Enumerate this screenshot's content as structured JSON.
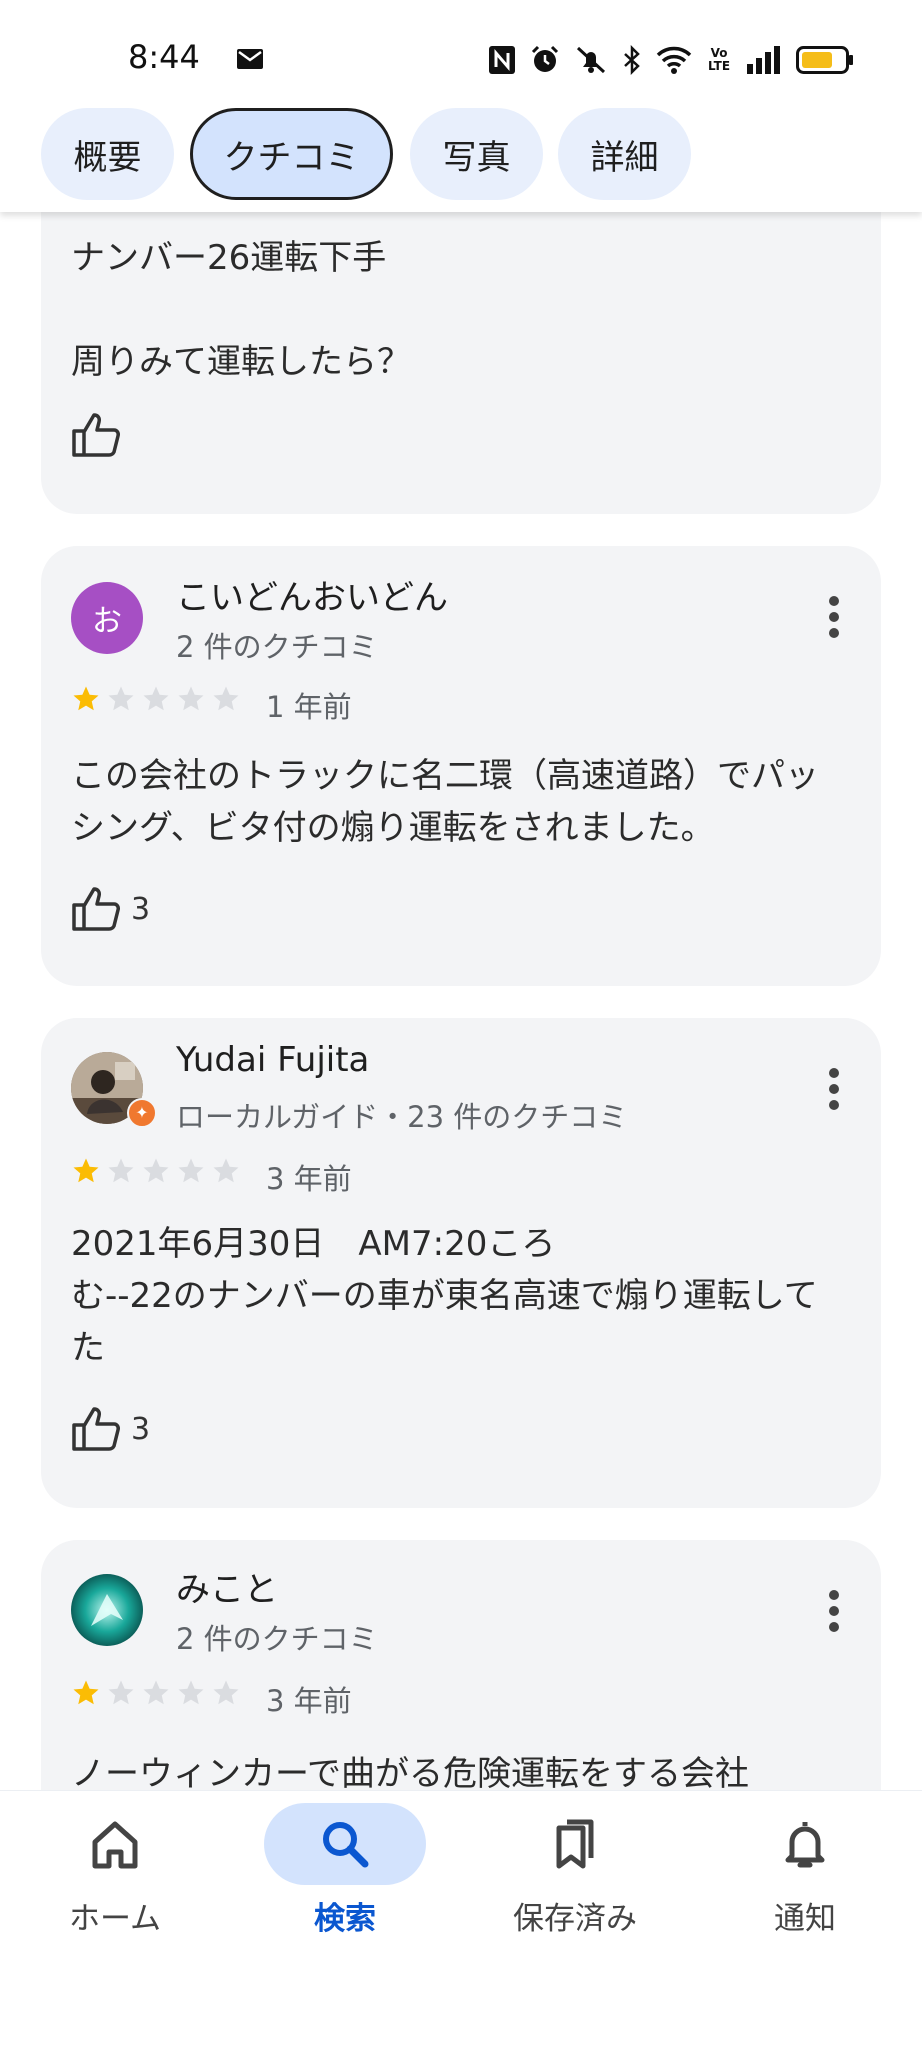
{
  "status": {
    "time": "8:44",
    "icons": [
      "mail-icon",
      "nfc-icon",
      "alarm-icon",
      "mute-icon",
      "bluetooth-icon",
      "wifi-icon",
      "volte-icon",
      "signal-icon",
      "battery-icon"
    ],
    "volte_text": "Vo LTE"
  },
  "tabs": [
    {
      "label": "概要",
      "active": false
    },
    {
      "label": "クチコミ",
      "active": true
    },
    {
      "label": "写真",
      "active": false
    },
    {
      "label": "詳細",
      "active": false
    }
  ],
  "reviews": [
    {
      "text": "ナンバー26運転下手\n\n周りみて運転したら？",
      "likes": ""
    },
    {
      "avatar_letter": "お",
      "avatar_color": "#a64fc4",
      "name": "こいどんおいどん",
      "meta": "2 件のクチコミ",
      "rating": 1,
      "age": "1 年前",
      "text": "この会社のトラックに名二環（高速道路）でパッシング、ビタ付の煽り運転をされました。",
      "likes": "3"
    },
    {
      "name": "Yudai Fujita",
      "meta": "ローカルガイド・23 件のクチコミ",
      "rating": 1,
      "age": "3 年前",
      "text": "2021年6月30日　AM7:20ころ\nむ--22のナンバーの車が東名高速で煽り運転してた",
      "likes": "3"
    },
    {
      "name": "みこと",
      "meta": "2 件のクチコミ",
      "rating": 1,
      "age": "3 年前",
      "text": "ノーウィンカーで曲がる危険運転をする会社"
    }
  ],
  "bottom_nav": [
    {
      "label": "ホーム",
      "icon": "home-icon",
      "active": false
    },
    {
      "label": "検索",
      "icon": "search-icon",
      "active": true
    },
    {
      "label": "保存済み",
      "icon": "bookmark-icon",
      "active": false
    },
    {
      "label": "通知",
      "icon": "bell-icon",
      "active": false
    }
  ],
  "colors": {
    "accent": "#0b57d0",
    "chip_bg": "#e8effc",
    "chip_active_bg": "#d3e3fd",
    "card_bg": "#f3f4f6",
    "star_filled": "#fbbc04",
    "star_empty": "#dadce0"
  }
}
